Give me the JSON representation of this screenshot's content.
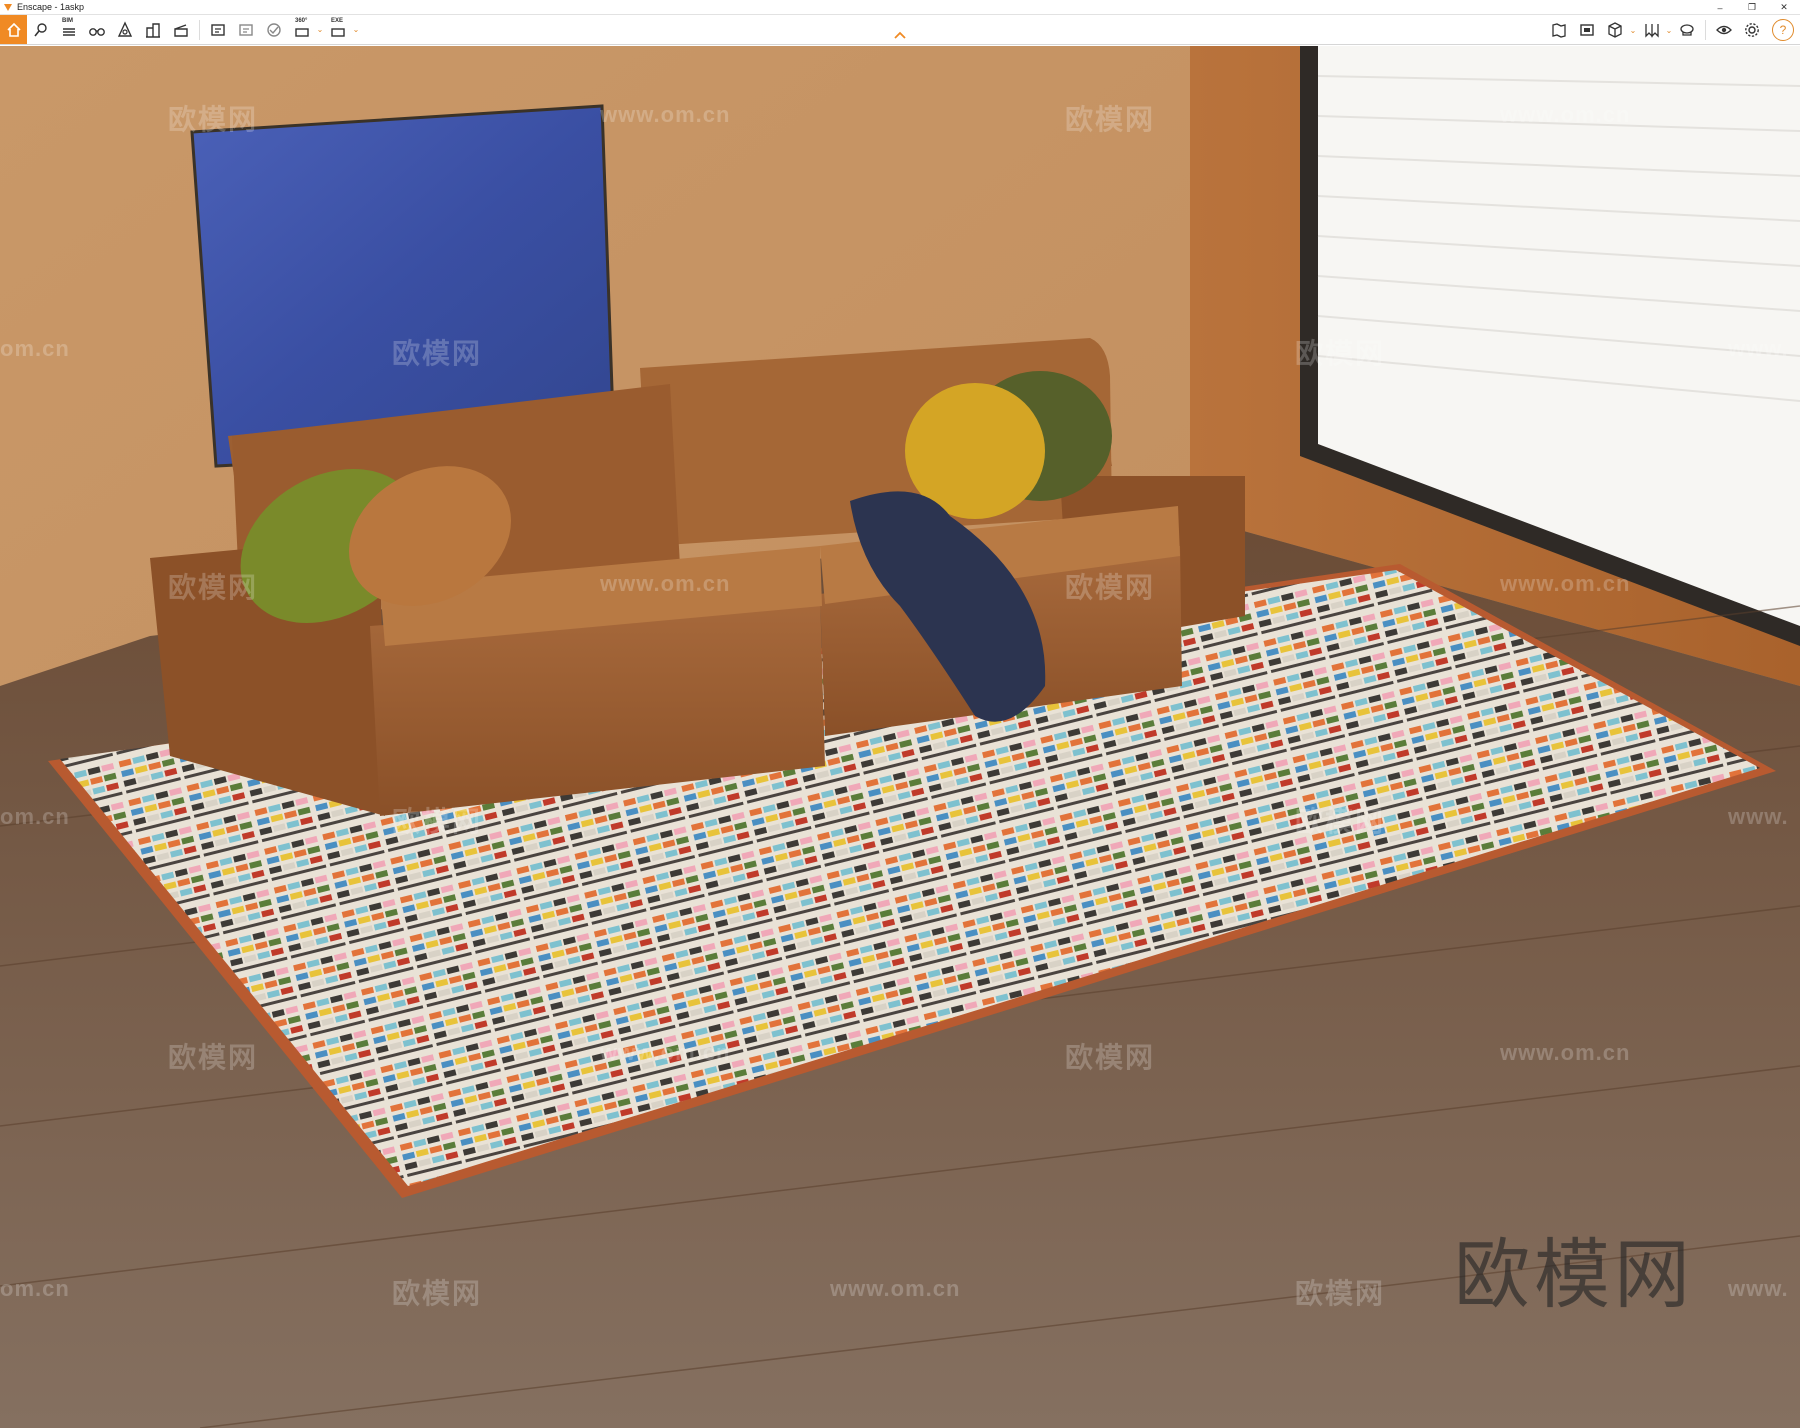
{
  "window": {
    "title": "Enscape - 1askp",
    "controls": [
      "–",
      "❐",
      "✕"
    ]
  },
  "toolbar": {
    "bim_tag": "BIM",
    "pano_tag": "360°",
    "exe_tag": "EXE",
    "caret": "⌄",
    "help_label": "?",
    "accent_color": "#f08a24",
    "left_icons": [
      "home-icon",
      "pin-icon",
      "bim-list-icon",
      "binoculars-icon",
      "asset-library-icon",
      "buildings-icon",
      "clapperboard-icon",
      "screenshot-icon",
      "batch-render-icon",
      "web-standalone-icon",
      "panorama-icon",
      "export-exe-icon"
    ],
    "right_icons": [
      "map-icon",
      "views-icon",
      "cube-icon",
      "bookmark-icon",
      "palette-icon",
      "eye-icon",
      "settings-icon",
      "help-icon"
    ]
  },
  "viewport": {
    "watermarks": [
      "欧模网",
      "www.om.cn",
      "om.cn",
      "www."
    ],
    "brand_watermark": "欧模网"
  }
}
